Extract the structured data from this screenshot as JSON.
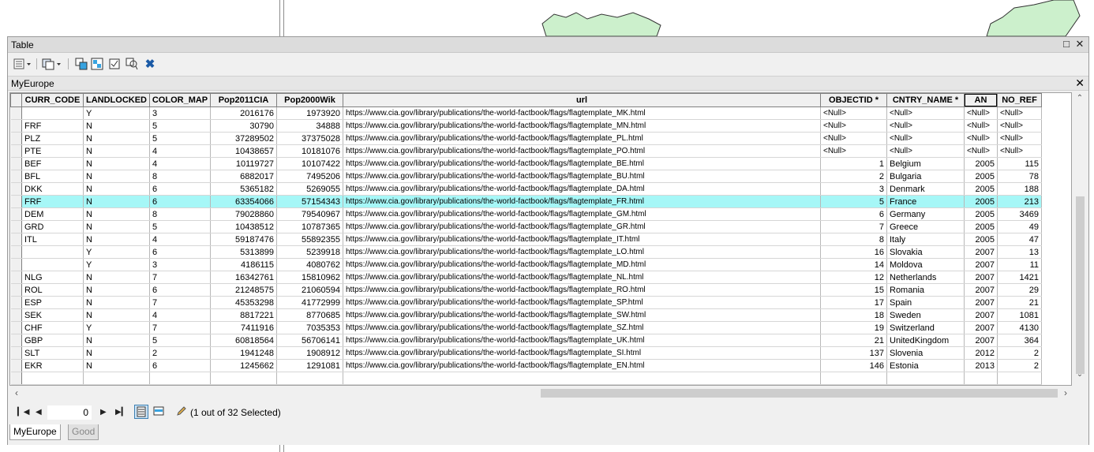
{
  "window": {
    "title": "Table"
  },
  "layer": {
    "name": "MyEurope"
  },
  "columns": [
    "",
    "CURR_CODE",
    "LANDLOCKED",
    "COLOR_MAP",
    "Pop2011CIA",
    "Pop2000Wik",
    "url",
    "OBJECTID *",
    "CNTRY_NAME *",
    "AN",
    "NO_REF"
  ],
  "rows": [
    [
      "",
      "Y",
      "3",
      "2016176",
      "1973920",
      "https://www.cia.gov/library/publications/the-world-factbook/flags/flagtemplate_MK.html",
      "<Null>",
      "<Null>",
      "<Null>",
      "<Null>"
    ],
    [
      "FRF",
      "N",
      "5",
      "30790",
      "34888",
      "https://www.cia.gov/library/publications/the-world-factbook/flags/flagtemplate_MN.html",
      "<Null>",
      "<Null>",
      "<Null>",
      "<Null>"
    ],
    [
      "PLZ",
      "N",
      "5",
      "37289502",
      "37375028",
      "https://www.cia.gov/library/publications/the-world-factbook/flags/flagtemplate_PL.html",
      "<Null>",
      "<Null>",
      "<Null>",
      "<Null>"
    ],
    [
      "PTE",
      "N",
      "4",
      "10438657",
      "10181076",
      "https://www.cia.gov/library/publications/the-world-factbook/flags/flagtemplate_PO.html",
      "<Null>",
      "<Null>",
      "<Null>",
      "<Null>"
    ],
    [
      "BEF",
      "N",
      "4",
      "10119727",
      "10107422",
      "https://www.cia.gov/library/publications/the-world-factbook/flags/flagtemplate_BE.html",
      "1",
      "Belgium",
      "2005",
      "115"
    ],
    [
      "BFL",
      "N",
      "8",
      "6882017",
      "7495206",
      "https://www.cia.gov/library/publications/the-world-factbook/flags/flagtemplate_BU.html",
      "2",
      "Bulgaria",
      "2005",
      "78"
    ],
    [
      "DKK",
      "N",
      "6",
      "5365182",
      "5269055",
      "https://www.cia.gov/library/publications/the-world-factbook/flags/flagtemplate_DA.html",
      "3",
      "Denmark",
      "2005",
      "188"
    ],
    [
      "FRF",
      "N",
      "6",
      "63354066",
      "57154343",
      "https://www.cia.gov/library/publications/the-world-factbook/flags/flagtemplate_FR.html",
      "5",
      "France",
      "2005",
      "213"
    ],
    [
      "DEM",
      "N",
      "8",
      "79028860",
      "79540967",
      "https://www.cia.gov/library/publications/the-world-factbook/flags/flagtemplate_GM.html",
      "6",
      "Germany",
      "2005",
      "3469"
    ],
    [
      "GRD",
      "N",
      "5",
      "10438512",
      "10787365",
      "https://www.cia.gov/library/publications/the-world-factbook/flags/flagtemplate_GR.html",
      "7",
      "Greece",
      "2005",
      "49"
    ],
    [
      "ITL",
      "N",
      "4",
      "59187476",
      "55892355",
      "https://www.cia.gov/library/publications/the-world-factbook/flags/flagtemplate_IT.html",
      "8",
      "Italy",
      "2005",
      "47"
    ],
    [
      "",
      "Y",
      "6",
      "5313899",
      "5239918",
      "https://www.cia.gov/library/publications/the-world-factbook/flags/flagtemplate_LO.html",
      "16",
      "Slovakia",
      "2007",
      "13"
    ],
    [
      "",
      "Y",
      "3",
      "4186115",
      "4080762",
      "https://www.cia.gov/library/publications/the-world-factbook/flags/flagtemplate_MD.html",
      "14",
      "Moldova",
      "2007",
      "11"
    ],
    [
      "NLG",
      "N",
      "7",
      "16342761",
      "15810962",
      "https://www.cia.gov/library/publications/the-world-factbook/flags/flagtemplate_NL.html",
      "12",
      "Netherlands",
      "2007",
      "1421"
    ],
    [
      "ROL",
      "N",
      "6",
      "21248575",
      "21060594",
      "https://www.cia.gov/library/publications/the-world-factbook/flags/flagtemplate_RO.html",
      "15",
      "Romania",
      "2007",
      "29"
    ],
    [
      "ESP",
      "N",
      "7",
      "45353298",
      "41772999",
      "https://www.cia.gov/library/publications/the-world-factbook/flags/flagtemplate_SP.html",
      "17",
      "Spain",
      "2007",
      "21"
    ],
    [
      "SEK",
      "N",
      "4",
      "8817221",
      "8770685",
      "https://www.cia.gov/library/publications/the-world-factbook/flags/flagtemplate_SW.html",
      "18",
      "Sweden",
      "2007",
      "1081"
    ],
    [
      "CHF",
      "Y",
      "7",
      "7411916",
      "7035353",
      "https://www.cia.gov/library/publications/the-world-factbook/flags/flagtemplate_SZ.html",
      "19",
      "Switzerland",
      "2007",
      "4130"
    ],
    [
      "GBP",
      "N",
      "5",
      "60818564",
      "56706141",
      "https://www.cia.gov/library/publications/the-world-factbook/flags/flagtemplate_UK.html",
      "21",
      "UnitedKingdom",
      "2007",
      "364"
    ],
    [
      "SLT",
      "N",
      "2",
      "1941248",
      "1908912",
      "https://www.cia.gov/library/publications/the-world-factbook/flags/flagtemplate_SI.html",
      "137",
      "Slovenia",
      "2012",
      "2"
    ],
    [
      "EKR",
      "N",
      "6",
      "1245662",
      "1291081",
      "https://www.cia.gov/library/publications/the-world-factbook/flags/flagtemplate_EN.html",
      "146",
      "Estonia",
      "2013",
      "2"
    ],
    [
      "",
      "",
      "",
      "",
      "",
      "",
      "",
      "",
      "",
      ""
    ]
  ],
  "selected_row_index": 7,
  "navigation": {
    "record": "0",
    "selection_text": "(1 out of 32 Selected)"
  },
  "tabs": [
    {
      "label": "MyEurope",
      "active": true
    },
    {
      "label": "Good",
      "active": false
    }
  ],
  "icons": {
    "table_options": "table-options-icon",
    "related_tables": "related-tables-icon",
    "select_by_attributes": "select-by-attributes-icon",
    "switch_selection": "switch-selection-icon",
    "clear_selection": "clear-selection-icon",
    "zoom_to_selected": "zoom-to-selected-icon",
    "delete_selected": "delete-selected-icon",
    "edit": "pencil-icon"
  },
  "colors": {
    "selected_row": "#a6f7f7",
    "map_land": "#ccf0cc"
  }
}
